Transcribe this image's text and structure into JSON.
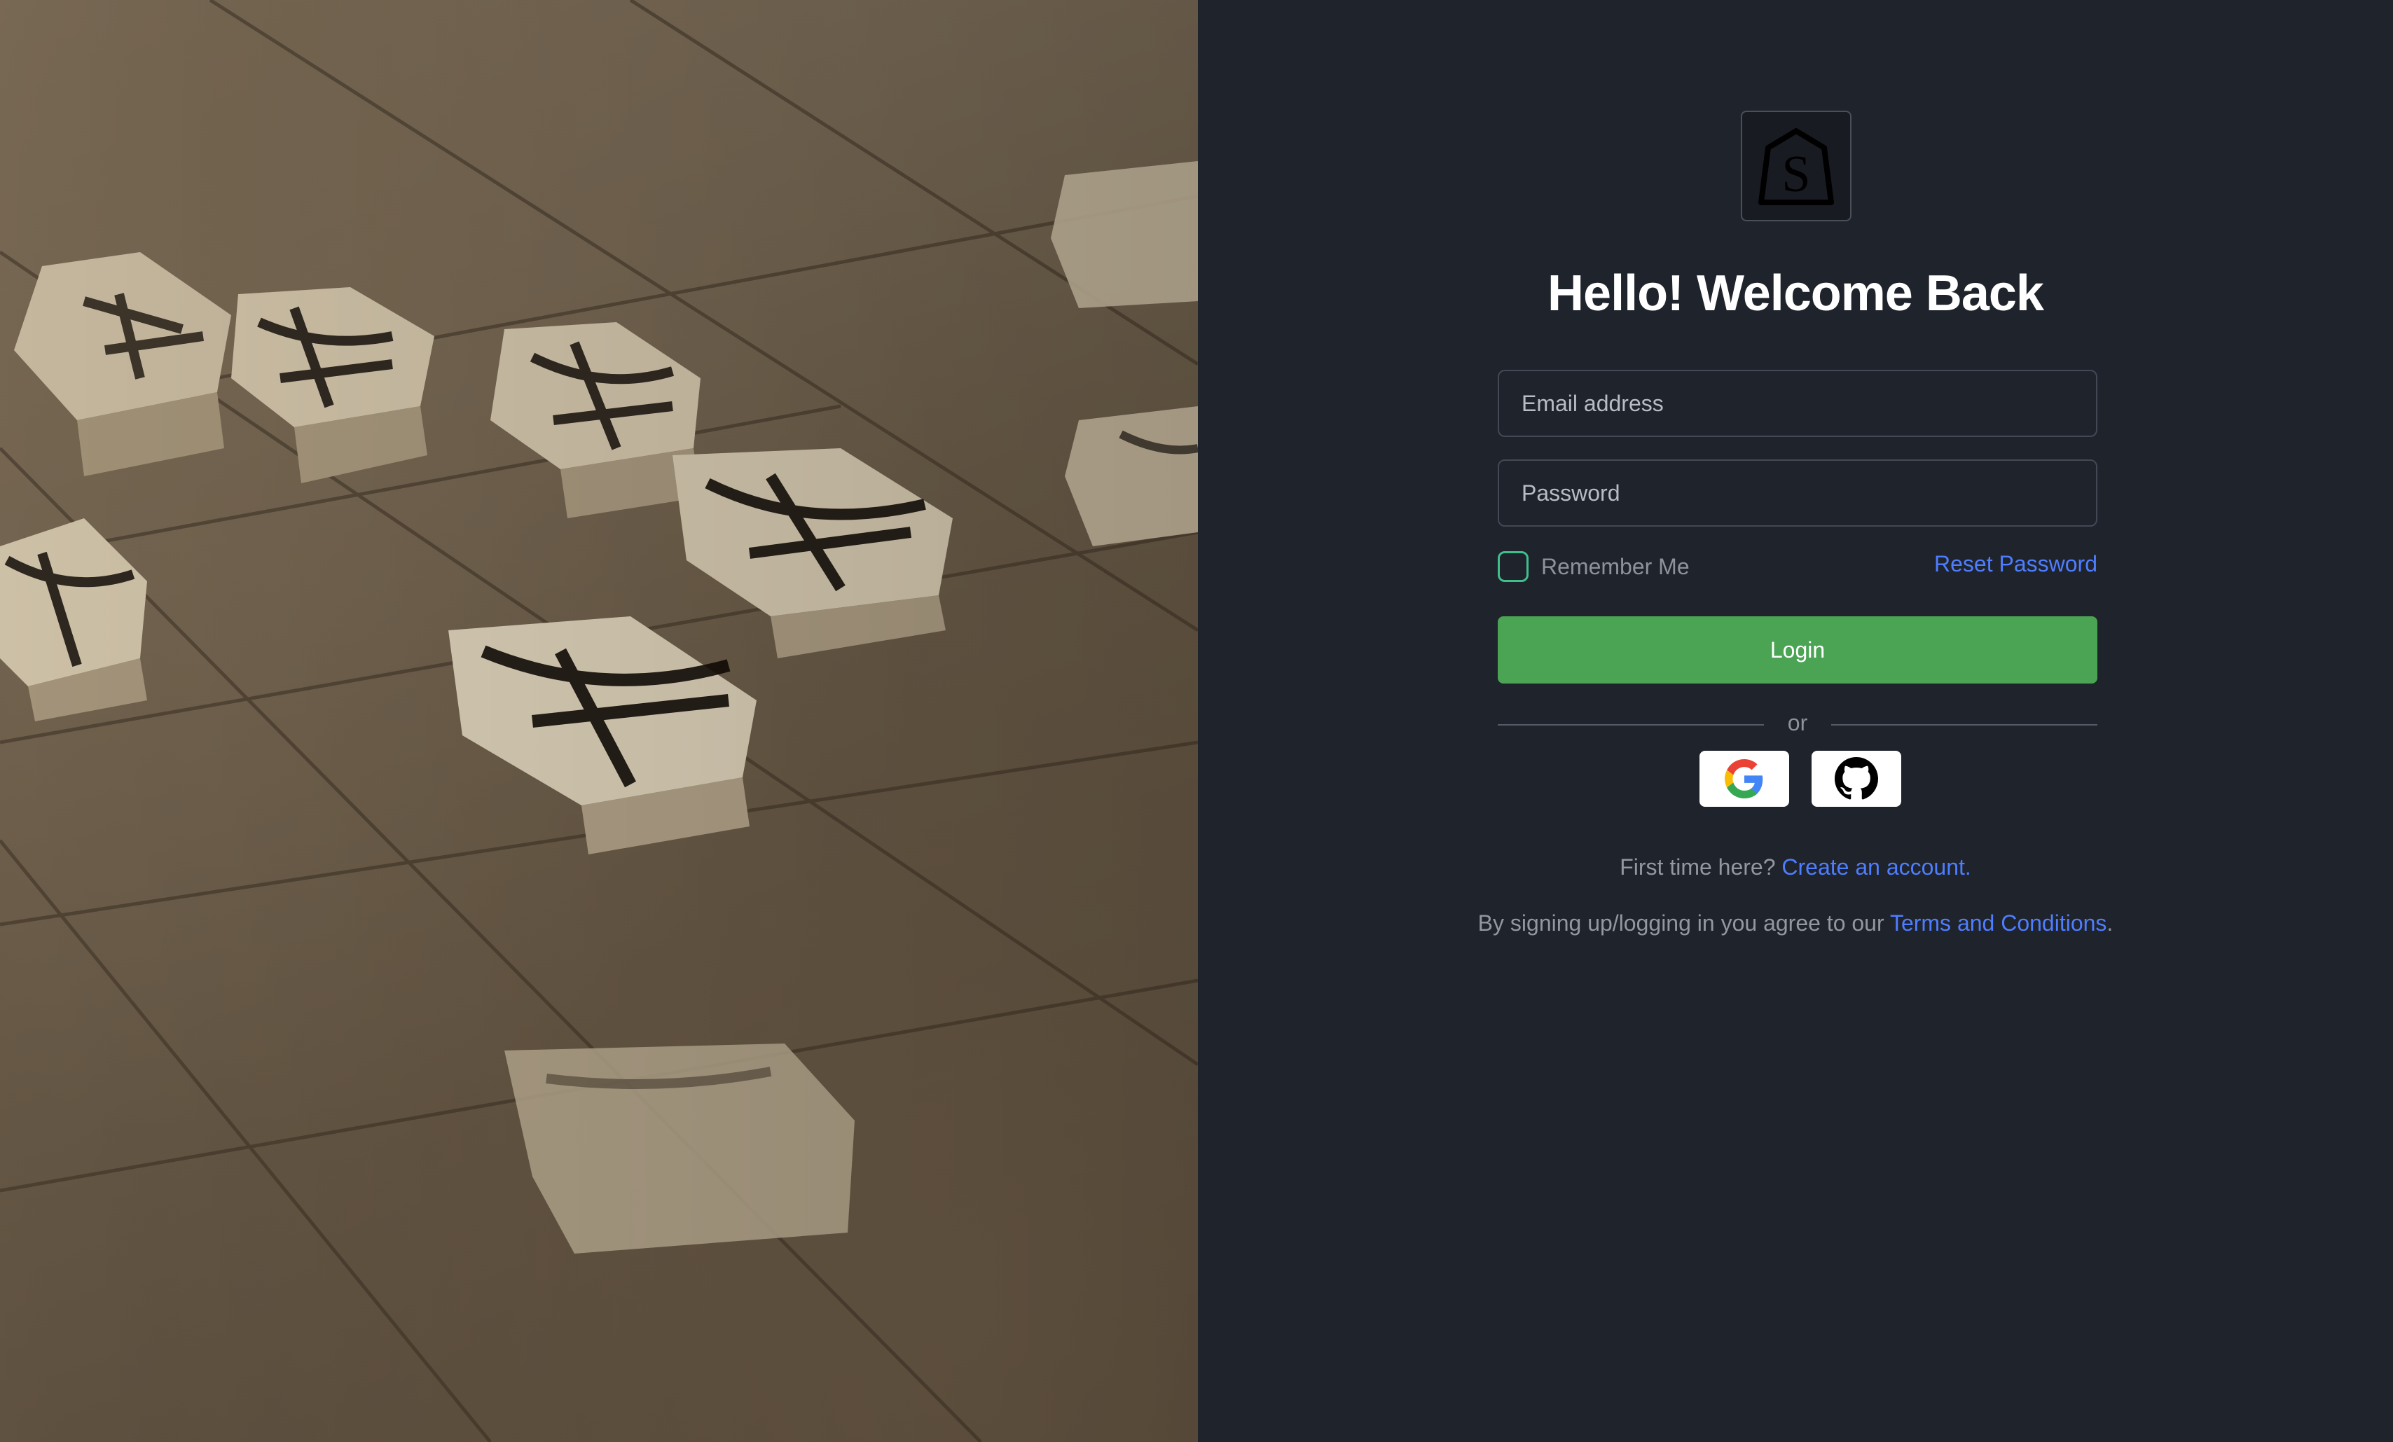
{
  "hero": {
    "image": "shogi-board-photo"
  },
  "logo": {
    "icon": "shogi-piece-s-logo",
    "letter": "S"
  },
  "title": "Hello! Welcome Back",
  "form": {
    "email_placeholder": "Email address",
    "email_value": "",
    "password_placeholder": "Password",
    "password_value": "",
    "remember_label": "Remember Me",
    "remember_checked": false,
    "reset_label": "Reset Password",
    "login_label": "Login"
  },
  "divider": {
    "text": "or"
  },
  "social": [
    {
      "name": "Google",
      "icon": "google-icon"
    },
    {
      "name": "GitHub",
      "icon": "github-icon"
    }
  ],
  "footer": {
    "first_prefix": "First time here? ",
    "create_link": "Create an account.",
    "terms_prefix": "By signing up/logging in you agree to our ",
    "terms_link": "Terms and Conditions",
    "terms_suffix": "."
  },
  "colors": {
    "panel_bg": "#1f232b",
    "login_button": "#4ba354",
    "link": "#4e7dff",
    "checkbox_border": "#3fbf8c"
  }
}
